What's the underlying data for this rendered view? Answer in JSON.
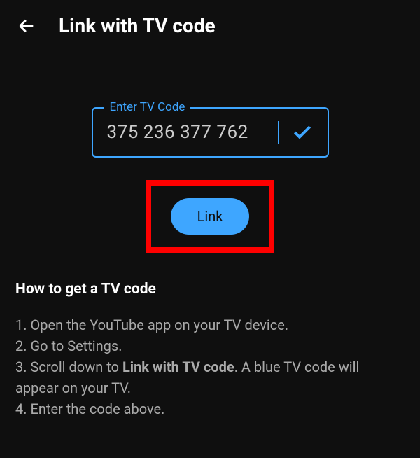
{
  "header": {
    "title": "Link with TV code"
  },
  "input": {
    "label": "Enter TV Code",
    "value": "375 236 377 762"
  },
  "link_button": {
    "label": "Link"
  },
  "instructions": {
    "title": "How to get a TV code",
    "step1_prefix": "1. ",
    "step1": "Open the YouTube app on your TV device.",
    "step2_prefix": "2. ",
    "step2": "Go to Settings.",
    "step3_prefix": "3. ",
    "step3_before": "Scroll down to ",
    "step3_bold": "Link with TV code",
    "step3_after": ". A blue TV code will appear on your TV.",
    "step4_prefix": "4. ",
    "step4": "Enter the code above."
  },
  "colors": {
    "accent": "#3ea6ff",
    "highlight": "#ff0000",
    "background": "#0f0f0f"
  }
}
